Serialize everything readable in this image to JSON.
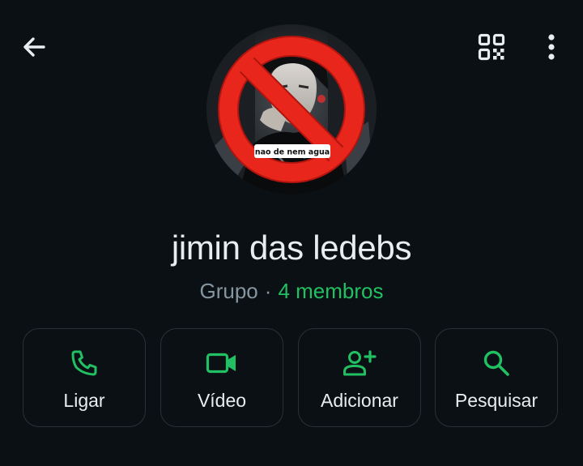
{
  "header": {
    "back_icon": "arrow-left-icon",
    "qr_icon": "qr-code-icon",
    "more_icon": "more-vertical-icon"
  },
  "avatar": {
    "caption": "nao de nem agua",
    "overlay_icon": "prohibited-icon",
    "overlay_color": "#e8261c"
  },
  "group": {
    "name": "jimin das ledebs",
    "type_label": "Grupo",
    "separator": "·",
    "members_label": "4 membros"
  },
  "actions": [
    {
      "label": "Ligar",
      "icon": "phone-icon"
    },
    {
      "label": "Vídeo",
      "icon": "video-icon"
    },
    {
      "label": "Adicionar",
      "icon": "add-person-icon"
    },
    {
      "label": "Pesquisar",
      "icon": "search-icon"
    }
  ],
  "colors": {
    "background": "#0b1014",
    "accent": "#21c063",
    "text_primary": "#e9edef",
    "text_secondary": "#8696a0",
    "button_border": "#2a3035"
  }
}
